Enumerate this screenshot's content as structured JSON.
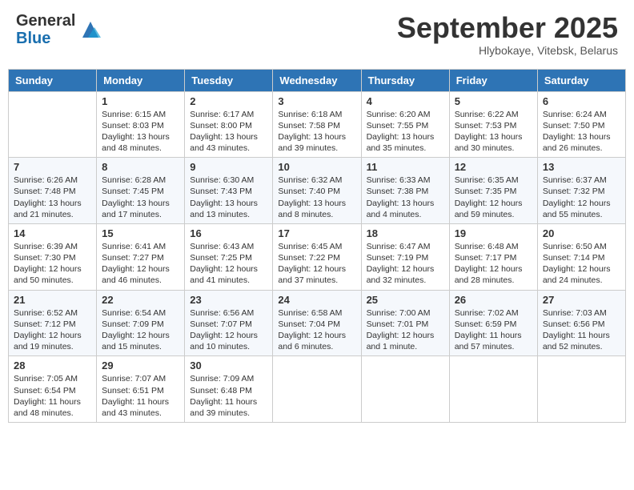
{
  "header": {
    "logo_general": "General",
    "logo_blue": "Blue",
    "month_title": "September 2025",
    "subtitle": "Hlybokaye, Vitebsk, Belarus"
  },
  "days_of_week": [
    "Sunday",
    "Monday",
    "Tuesday",
    "Wednesday",
    "Thursday",
    "Friday",
    "Saturday"
  ],
  "weeks": [
    [
      {
        "day": "",
        "sunrise": "",
        "sunset": "",
        "daylight": ""
      },
      {
        "day": "1",
        "sunrise": "Sunrise: 6:15 AM",
        "sunset": "Sunset: 8:03 PM",
        "daylight": "Daylight: 13 hours and 48 minutes."
      },
      {
        "day": "2",
        "sunrise": "Sunrise: 6:17 AM",
        "sunset": "Sunset: 8:00 PM",
        "daylight": "Daylight: 13 hours and 43 minutes."
      },
      {
        "day": "3",
        "sunrise": "Sunrise: 6:18 AM",
        "sunset": "Sunset: 7:58 PM",
        "daylight": "Daylight: 13 hours and 39 minutes."
      },
      {
        "day": "4",
        "sunrise": "Sunrise: 6:20 AM",
        "sunset": "Sunset: 7:55 PM",
        "daylight": "Daylight: 13 hours and 35 minutes."
      },
      {
        "day": "5",
        "sunrise": "Sunrise: 6:22 AM",
        "sunset": "Sunset: 7:53 PM",
        "daylight": "Daylight: 13 hours and 30 minutes."
      },
      {
        "day": "6",
        "sunrise": "Sunrise: 6:24 AM",
        "sunset": "Sunset: 7:50 PM",
        "daylight": "Daylight: 13 hours and 26 minutes."
      }
    ],
    [
      {
        "day": "7",
        "sunrise": "Sunrise: 6:26 AM",
        "sunset": "Sunset: 7:48 PM",
        "daylight": "Daylight: 13 hours and 21 minutes."
      },
      {
        "day": "8",
        "sunrise": "Sunrise: 6:28 AM",
        "sunset": "Sunset: 7:45 PM",
        "daylight": "Daylight: 13 hours and 17 minutes."
      },
      {
        "day": "9",
        "sunrise": "Sunrise: 6:30 AM",
        "sunset": "Sunset: 7:43 PM",
        "daylight": "Daylight: 13 hours and 13 minutes."
      },
      {
        "day": "10",
        "sunrise": "Sunrise: 6:32 AM",
        "sunset": "Sunset: 7:40 PM",
        "daylight": "Daylight: 13 hours and 8 minutes."
      },
      {
        "day": "11",
        "sunrise": "Sunrise: 6:33 AM",
        "sunset": "Sunset: 7:38 PM",
        "daylight": "Daylight: 13 hours and 4 minutes."
      },
      {
        "day": "12",
        "sunrise": "Sunrise: 6:35 AM",
        "sunset": "Sunset: 7:35 PM",
        "daylight": "Daylight: 12 hours and 59 minutes."
      },
      {
        "day": "13",
        "sunrise": "Sunrise: 6:37 AM",
        "sunset": "Sunset: 7:32 PM",
        "daylight": "Daylight: 12 hours and 55 minutes."
      }
    ],
    [
      {
        "day": "14",
        "sunrise": "Sunrise: 6:39 AM",
        "sunset": "Sunset: 7:30 PM",
        "daylight": "Daylight: 12 hours and 50 minutes."
      },
      {
        "day": "15",
        "sunrise": "Sunrise: 6:41 AM",
        "sunset": "Sunset: 7:27 PM",
        "daylight": "Daylight: 12 hours and 46 minutes."
      },
      {
        "day": "16",
        "sunrise": "Sunrise: 6:43 AM",
        "sunset": "Sunset: 7:25 PM",
        "daylight": "Daylight: 12 hours and 41 minutes."
      },
      {
        "day": "17",
        "sunrise": "Sunrise: 6:45 AM",
        "sunset": "Sunset: 7:22 PM",
        "daylight": "Daylight: 12 hours and 37 minutes."
      },
      {
        "day": "18",
        "sunrise": "Sunrise: 6:47 AM",
        "sunset": "Sunset: 7:19 PM",
        "daylight": "Daylight: 12 hours and 32 minutes."
      },
      {
        "day": "19",
        "sunrise": "Sunrise: 6:48 AM",
        "sunset": "Sunset: 7:17 PM",
        "daylight": "Daylight: 12 hours and 28 minutes."
      },
      {
        "day": "20",
        "sunrise": "Sunrise: 6:50 AM",
        "sunset": "Sunset: 7:14 PM",
        "daylight": "Daylight: 12 hours and 24 minutes."
      }
    ],
    [
      {
        "day": "21",
        "sunrise": "Sunrise: 6:52 AM",
        "sunset": "Sunset: 7:12 PM",
        "daylight": "Daylight: 12 hours and 19 minutes."
      },
      {
        "day": "22",
        "sunrise": "Sunrise: 6:54 AM",
        "sunset": "Sunset: 7:09 PM",
        "daylight": "Daylight: 12 hours and 15 minutes."
      },
      {
        "day": "23",
        "sunrise": "Sunrise: 6:56 AM",
        "sunset": "Sunset: 7:07 PM",
        "daylight": "Daylight: 12 hours and 10 minutes."
      },
      {
        "day": "24",
        "sunrise": "Sunrise: 6:58 AM",
        "sunset": "Sunset: 7:04 PM",
        "daylight": "Daylight: 12 hours and 6 minutes."
      },
      {
        "day": "25",
        "sunrise": "Sunrise: 7:00 AM",
        "sunset": "Sunset: 7:01 PM",
        "daylight": "Daylight: 12 hours and 1 minute."
      },
      {
        "day": "26",
        "sunrise": "Sunrise: 7:02 AM",
        "sunset": "Sunset: 6:59 PM",
        "daylight": "Daylight: 11 hours and 57 minutes."
      },
      {
        "day": "27",
        "sunrise": "Sunrise: 7:03 AM",
        "sunset": "Sunset: 6:56 PM",
        "daylight": "Daylight: 11 hours and 52 minutes."
      }
    ],
    [
      {
        "day": "28",
        "sunrise": "Sunrise: 7:05 AM",
        "sunset": "Sunset: 6:54 PM",
        "daylight": "Daylight: 11 hours and 48 minutes."
      },
      {
        "day": "29",
        "sunrise": "Sunrise: 7:07 AM",
        "sunset": "Sunset: 6:51 PM",
        "daylight": "Daylight: 11 hours and 43 minutes."
      },
      {
        "day": "30",
        "sunrise": "Sunrise: 7:09 AM",
        "sunset": "Sunset: 6:48 PM",
        "daylight": "Daylight: 11 hours and 39 minutes."
      },
      {
        "day": "",
        "sunrise": "",
        "sunset": "",
        "daylight": ""
      },
      {
        "day": "",
        "sunrise": "",
        "sunset": "",
        "daylight": ""
      },
      {
        "day": "",
        "sunrise": "",
        "sunset": "",
        "daylight": ""
      },
      {
        "day": "",
        "sunrise": "",
        "sunset": "",
        "daylight": ""
      }
    ]
  ]
}
